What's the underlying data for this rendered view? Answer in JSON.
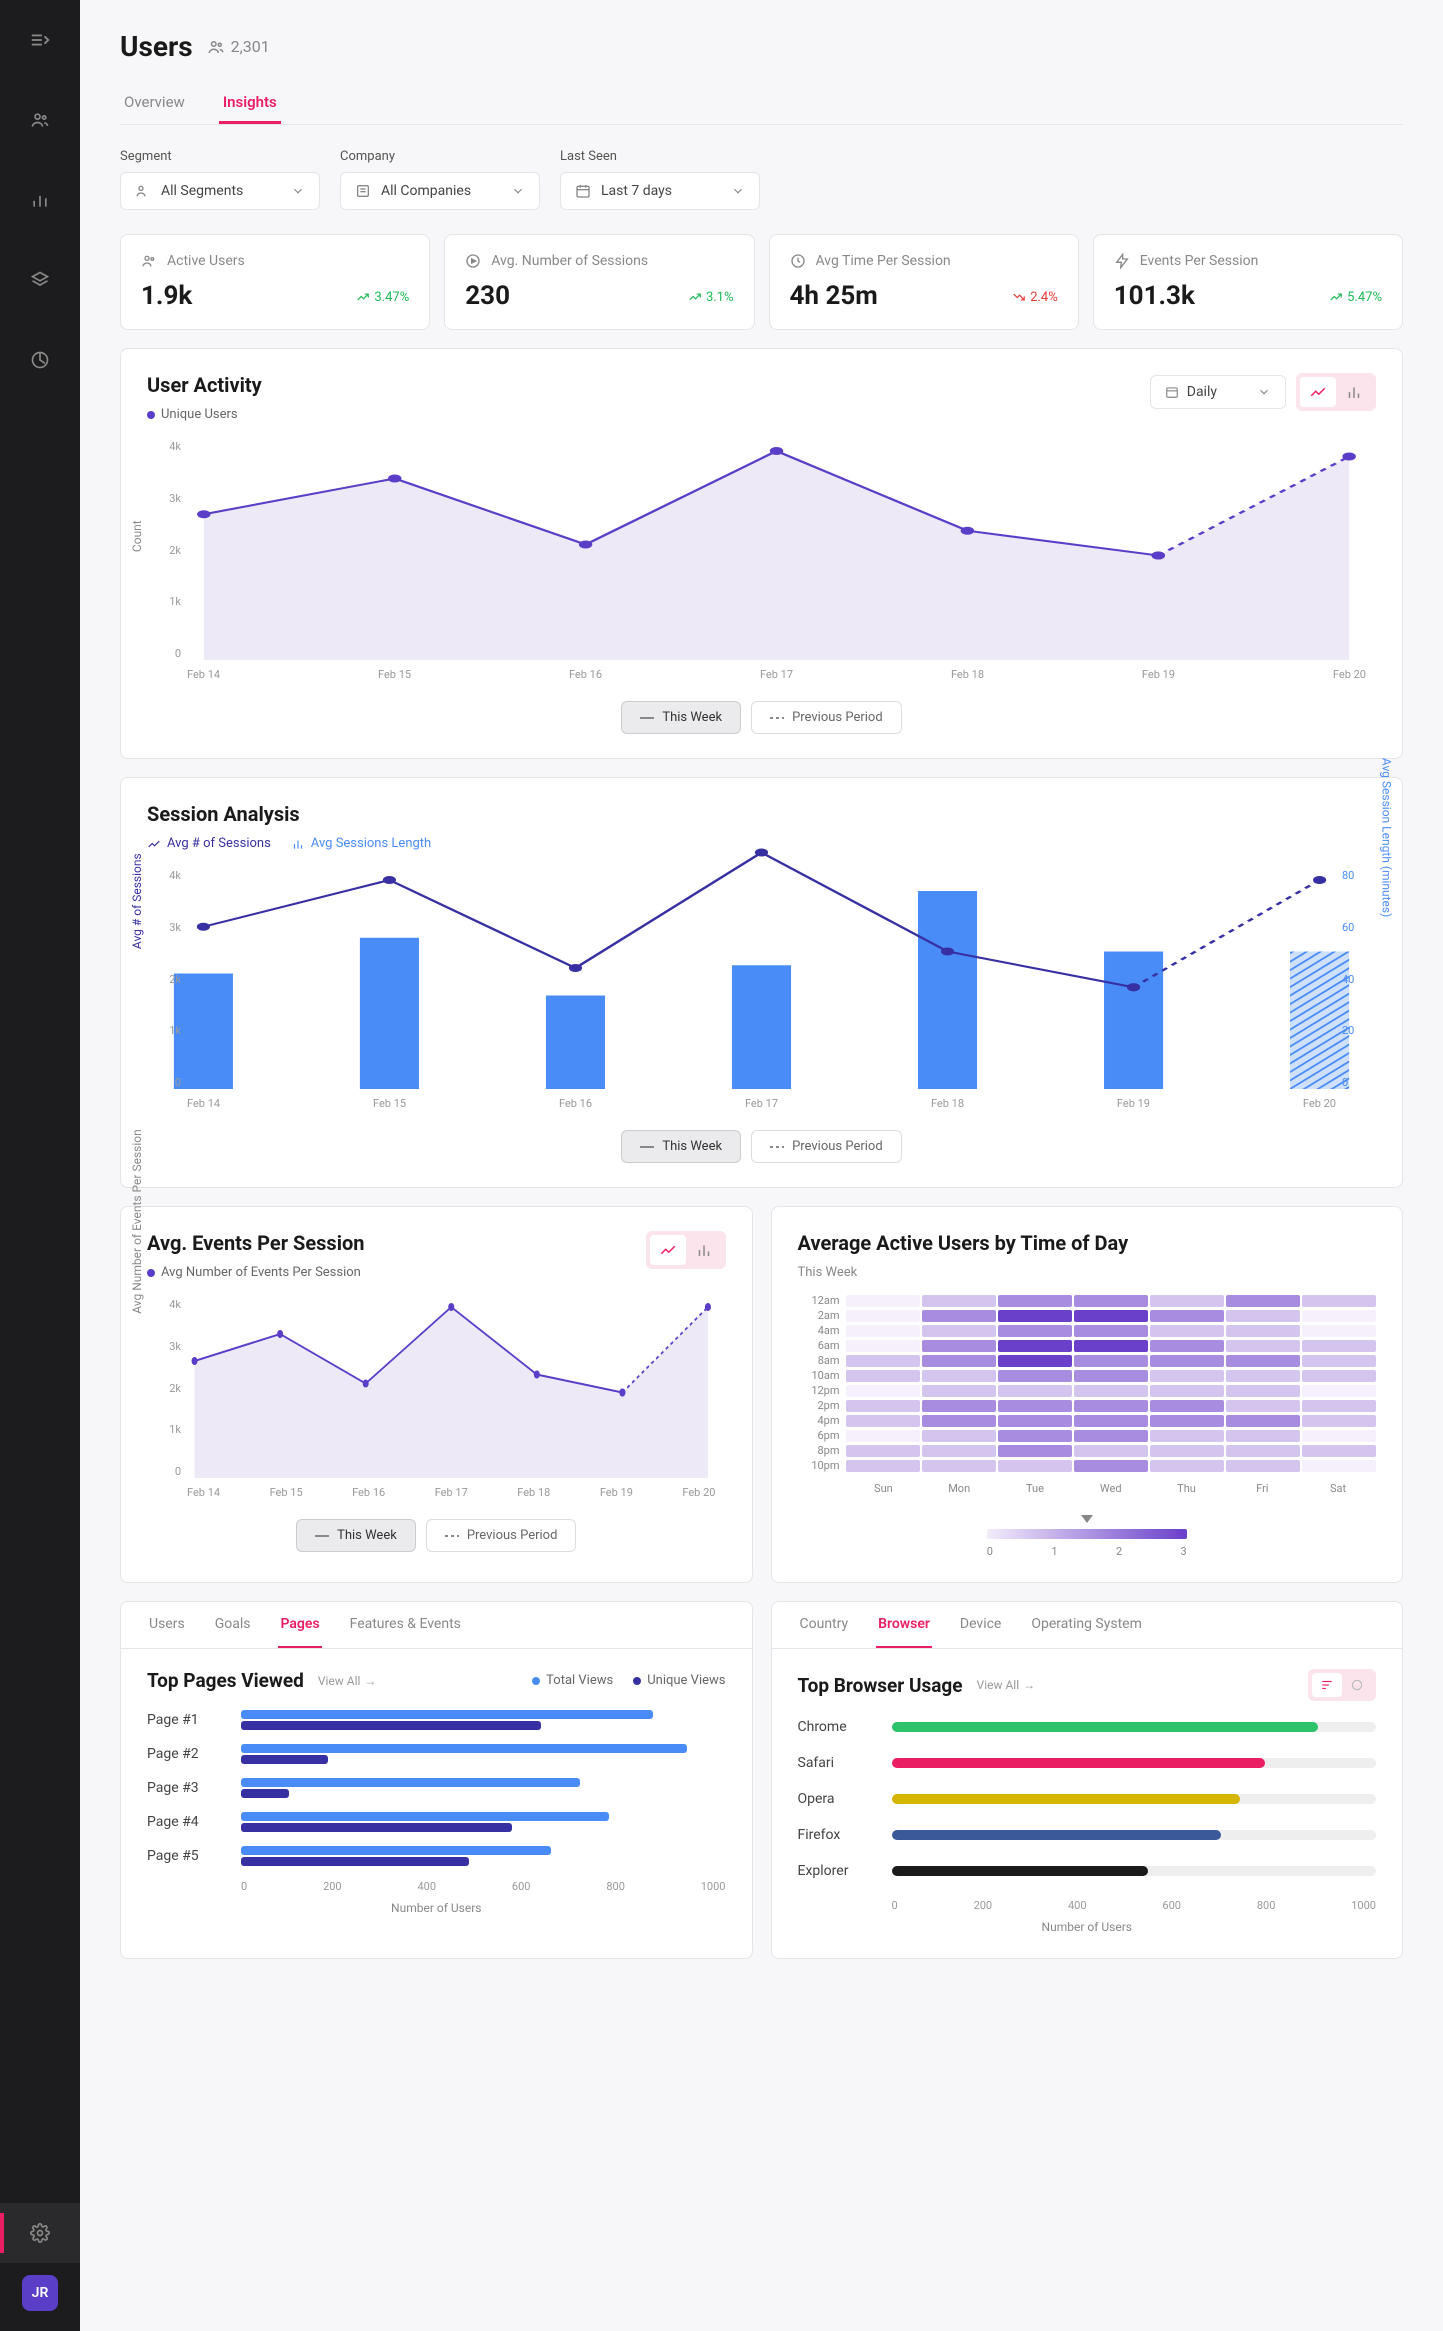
{
  "page": {
    "title": "Users",
    "count": "2,301",
    "tabs": {
      "overview": "Overview",
      "insights": "Insights"
    }
  },
  "filters": {
    "segment": {
      "label": "Segment",
      "value": "All Segments"
    },
    "company": {
      "label": "Company",
      "value": "All Companies"
    },
    "last_seen": {
      "label": "Last Seen",
      "value": "Last 7 days"
    }
  },
  "kpis": {
    "active_users": {
      "label": "Active Users",
      "value": "1.9k",
      "delta": "3.47%",
      "dir": "up"
    },
    "avg_sessions": {
      "label": "Avg. Number of Sessions",
      "value": "230",
      "delta": "3.1%",
      "dir": "up"
    },
    "avg_time": {
      "label": "Avg Time Per Session",
      "value": "4h 25m",
      "delta": "2.4%",
      "dir": "down"
    },
    "events": {
      "label": "Events Per Session",
      "value": "101.3k",
      "delta": "5.47%",
      "dir": "up"
    }
  },
  "userActivity": {
    "title": "User Activity",
    "legend": "Unique Users",
    "granularity": "Daily",
    "ylabel": "Count",
    "btns": {
      "tw": "This Week",
      "pp": "Previous Period"
    }
  },
  "sessionAnalysis": {
    "title": "Session Analysis",
    "legend1": "Avg # of Sessions",
    "legend2": "Avg Sessions Length",
    "ylabel": "Avg # of Sessions",
    "ylabel2": "Avg Session Length (minutes)"
  },
  "avgEvents": {
    "title": "Avg. Events Per Session",
    "legend": "Avg Number of Events Per Session",
    "ylabel": "Avg Number of Events Per Session"
  },
  "heatmap": {
    "title": "Average Active Users by Time of Day",
    "sub": "This Week"
  },
  "topPages": {
    "tabs": {
      "users": "Users",
      "goals": "Goals",
      "pages": "Pages",
      "fe": "Features & Events"
    },
    "title": "Top Pages Viewed",
    "viewAll": "View All",
    "legend1": "Total Views",
    "legend2": "Unique Views",
    "xlabel": "Number of Users"
  },
  "topBrowser": {
    "tabs": {
      "country": "Country",
      "browser": "Browser",
      "device": "Device",
      "os": "Operating System"
    },
    "title": "Top Browser Usage",
    "viewAll": "View All",
    "xlabel": "Number of Users"
  },
  "avatar": "JR",
  "chart_data": [
    {
      "id": "user_activity",
      "type": "area",
      "title": "User Activity",
      "xlabel": "",
      "ylabel": "Count",
      "ylim": [
        0,
        4000
      ],
      "categories": [
        "Feb 14",
        "Feb 15",
        "Feb 16",
        "Feb 17",
        "Feb 18",
        "Feb 19",
        "Feb 20"
      ],
      "series": [
        {
          "name": "Unique Users (This Week)",
          "values": [
            2650,
            3300,
            2100,
            3800,
            2350,
            1900,
            null
          ],
          "line": "solid"
        },
        {
          "name": "Unique Users (Previous Period)",
          "values": [
            null,
            null,
            null,
            null,
            null,
            1900,
            3700
          ],
          "line": "dashed"
        }
      ]
    },
    {
      "id": "session_analysis",
      "type": "bar_line_combo",
      "title": "Session Analysis",
      "categories": [
        "Feb 14",
        "Feb 15",
        "Feb 16",
        "Feb 17",
        "Feb 18",
        "Feb 19",
        "Feb 20"
      ],
      "y1": {
        "label": "Avg # of Sessions",
        "lim": [
          0,
          4000
        ]
      },
      "y2": {
        "label": "Avg Session Length (minutes)",
        "lim": [
          0,
          80
        ]
      },
      "series": [
        {
          "name": "Avg Session Length",
          "axis": "y2",
          "type": "bar",
          "values": [
            42,
            55,
            34,
            45,
            72,
            50,
            50
          ]
        },
        {
          "name": "Avg # of Sessions (This Week)",
          "axis": "y1",
          "type": "line",
          "values": [
            2950,
            3800,
            2200,
            4300,
            2500,
            1850,
            null
          ],
          "line": "solid"
        },
        {
          "name": "Avg # of Sessions (Previous)",
          "axis": "y1",
          "type": "line",
          "values": [
            null,
            null,
            null,
            null,
            null,
            1850,
            3800
          ],
          "line": "dashed"
        }
      ]
    },
    {
      "id": "avg_events",
      "type": "area",
      "title": "Avg. Events Per Session",
      "ylabel": "Avg Number of Events Per Session",
      "ylim": [
        0,
        4000
      ],
      "categories": [
        "Feb 14",
        "Feb 15",
        "Feb 16",
        "Feb 17",
        "Feb 18",
        "Feb 19",
        "Feb 20"
      ],
      "series": [
        {
          "name": "This Week",
          "values": [
            2600,
            3200,
            2100,
            3800,
            2300,
            1900,
            null
          ],
          "line": "solid"
        },
        {
          "name": "Previous Period",
          "values": [
            null,
            null,
            null,
            null,
            null,
            1900,
            3800
          ],
          "line": "dashed"
        }
      ]
    },
    {
      "id": "heatmap",
      "type": "heatmap",
      "title": "Average Active Users by Time of Day",
      "rows": [
        "12am",
        "2am",
        "4am",
        "6am",
        "8am",
        "10am",
        "12pm",
        "2pm",
        "4pm",
        "6pm",
        "8pm",
        "10pm"
      ],
      "cols": [
        "Sun",
        "Mon",
        "Tue",
        "Wed",
        "Thu",
        "Fri",
        "Sat"
      ],
      "scale": [
        0,
        1,
        2,
        3
      ],
      "values": [
        [
          0,
          1,
          2,
          2,
          1,
          2,
          1
        ],
        [
          0,
          2,
          3,
          3,
          2,
          1,
          0
        ],
        [
          0,
          1,
          2,
          2,
          1,
          1,
          0
        ],
        [
          0,
          2,
          3,
          3,
          2,
          1,
          1
        ],
        [
          1,
          2,
          3,
          2,
          2,
          2,
          1
        ],
        [
          1,
          1,
          2,
          2,
          1,
          1,
          1
        ],
        [
          0,
          1,
          1,
          1,
          1,
          1,
          0
        ],
        [
          1,
          2,
          2,
          2,
          2,
          1,
          1
        ],
        [
          1,
          2,
          2,
          2,
          2,
          2,
          1
        ],
        [
          0,
          1,
          2,
          2,
          1,
          1,
          0
        ],
        [
          1,
          1,
          2,
          1,
          1,
          1,
          1
        ],
        [
          1,
          1,
          1,
          2,
          1,
          1,
          0
        ]
      ]
    },
    {
      "id": "top_pages",
      "type": "bar_horizontal",
      "title": "Top Pages Viewed",
      "xlabel": "Number of Users",
      "xlim": [
        0,
        1000
      ],
      "x_ticks": [
        0,
        200,
        400,
        600,
        800,
        1000
      ],
      "categories": [
        "Page #1",
        "Page #2",
        "Page #3",
        "Page #4",
        "Page #5"
      ],
      "series": [
        {
          "name": "Total Views",
          "color": "#4a8cf7",
          "values": [
            850,
            920,
            700,
            760,
            640
          ]
        },
        {
          "name": "Unique Views",
          "color": "#3730a3",
          "values": [
            620,
            180,
            100,
            560,
            470
          ]
        }
      ]
    },
    {
      "id": "browser_usage",
      "type": "bar_horizontal",
      "title": "Top Browser Usage",
      "xlabel": "Number of Users",
      "xlim": [
        0,
        1000
      ],
      "x_ticks": [
        0,
        200,
        400,
        600,
        800,
        1000
      ],
      "categories": [
        "Chrome",
        "Safari",
        "Opera",
        "Firefox",
        "Explorer"
      ],
      "series": [
        {
          "name": "Users",
          "values": [
            880,
            770,
            720,
            680,
            530
          ],
          "colors": [
            "#2cc36b",
            "#e91e63",
            "#d4b500",
            "#3b5998",
            "#1a1a1a"
          ]
        }
      ]
    }
  ]
}
